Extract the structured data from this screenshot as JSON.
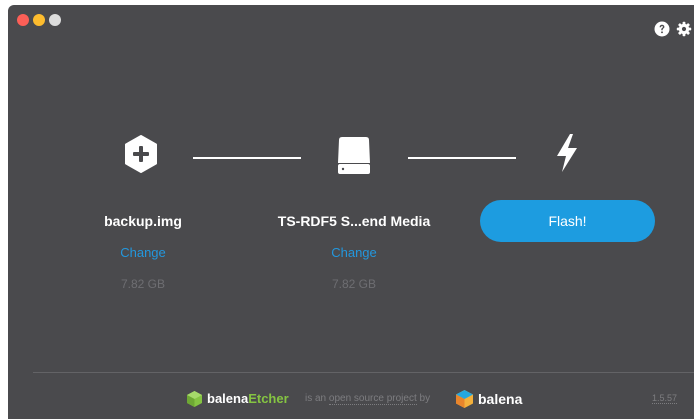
{
  "window": {
    "traffic_lights": [
      "close",
      "minimize",
      "zoom"
    ],
    "colors": {
      "background": "#4a4a4d",
      "accent": "#1d9ce0",
      "link": "#2397dd",
      "muted": "#6e6e72",
      "etcher_green": "#85c442"
    }
  },
  "toolbar": {
    "icons": [
      "help-icon",
      "settings-gear-icon"
    ]
  },
  "steps": {
    "image": {
      "icon": "plus-hexagon-icon",
      "name": "backup.img",
      "change": "Change",
      "size": "7.82 GB"
    },
    "drive": {
      "icon": "drive-icon",
      "name": "TS-RDF5 S...end Media",
      "change": "Change",
      "size": "7.82 GB"
    },
    "flash": {
      "icon": "lightning-bolt-icon",
      "button": "Flash!"
    }
  },
  "footer": {
    "brand_prefix": "balena",
    "brand_suffix": "Etcher",
    "middle_pre": "is an ",
    "middle_link": "open source project",
    "middle_post": " by",
    "company": "balena",
    "version": "1.5.57"
  }
}
